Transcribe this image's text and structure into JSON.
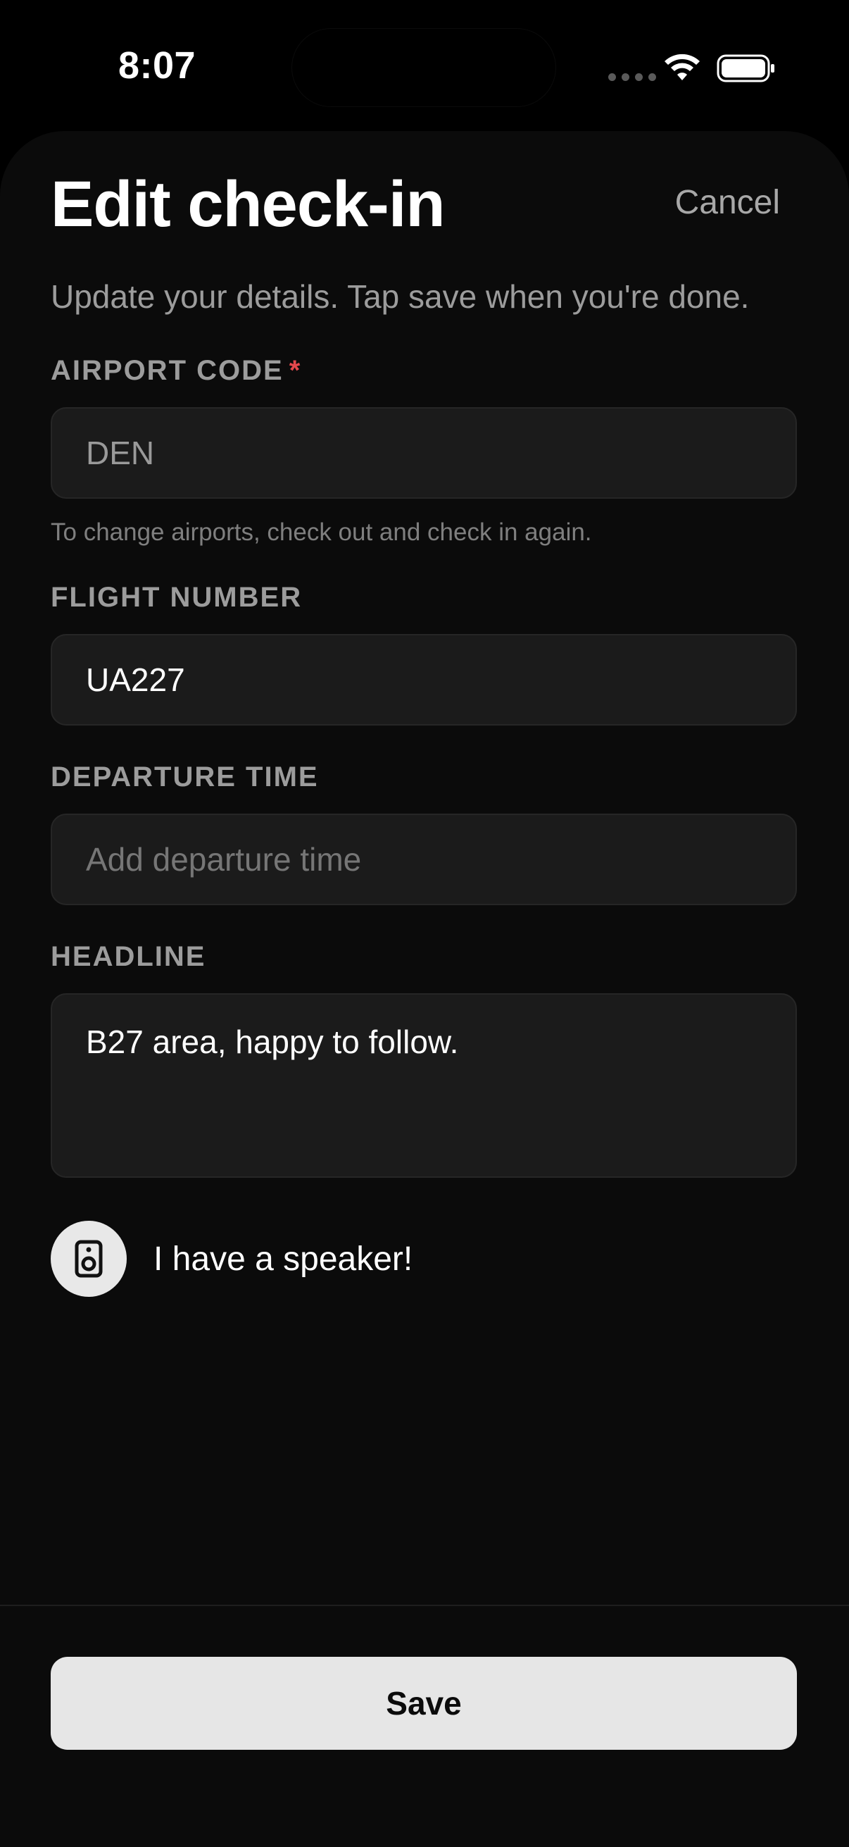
{
  "status_bar": {
    "time": "8:07"
  },
  "header": {
    "title": "Edit check-in",
    "cancel_label": "Cancel"
  },
  "subtitle": "Update your details. Tap save when you're done.",
  "fields": {
    "airport_code": {
      "label": "AIRPORT CODE",
      "required_marker": "*",
      "value": "DEN",
      "helper": "To change airports, check out and check in again."
    },
    "flight_number": {
      "label": "FLIGHT NUMBER",
      "value": "UA227"
    },
    "departure_time": {
      "label": "DEPARTURE TIME",
      "value": "",
      "placeholder": "Add departure time"
    },
    "headline": {
      "label": "HEADLINE",
      "value": "B27 area, happy to follow."
    }
  },
  "speaker_option": {
    "icon": "speaker-icon",
    "label": "I have a speaker!"
  },
  "footer": {
    "save_label": "Save"
  },
  "colors": {
    "background": "#000000",
    "sheet": "#0b0b0b",
    "input_bg": "#1b1b1b",
    "required": "#e5484d",
    "save_button": "#e6e6e6"
  }
}
